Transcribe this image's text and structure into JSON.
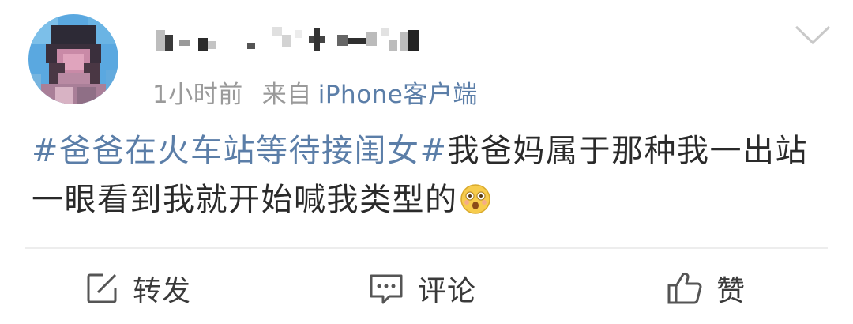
{
  "post": {
    "time": "1小时前",
    "source_prefix": "来自",
    "source": "iPhone客户端",
    "hashtag": "#爸爸在火车站等待接闺女#",
    "text": "我爸妈属于那种我一出站一眼看到我就开始喊我类型的",
    "emoji": "dizzy-face-emoji"
  },
  "actions": {
    "repost_label": "转发",
    "comment_label": "评论",
    "like_label": "赞"
  },
  "colors": {
    "link": "#5b7ea8",
    "meta": "#9a9a9a",
    "text": "#2a2a2a",
    "divider": "#ededed"
  }
}
